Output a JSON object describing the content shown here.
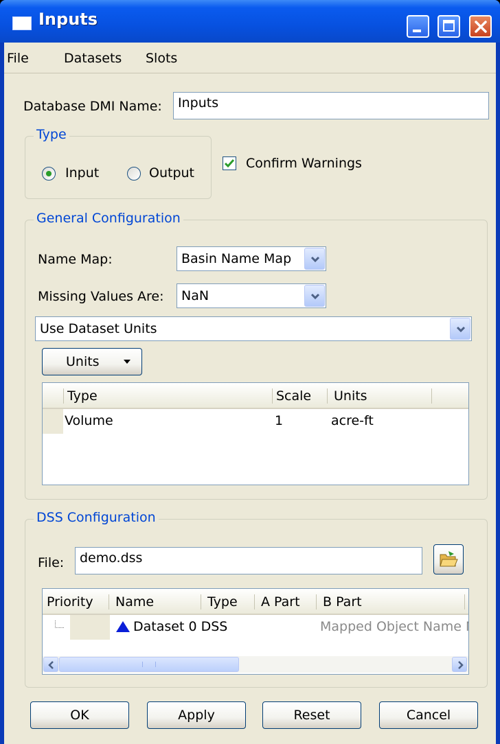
{
  "window": {
    "title": "Inputs",
    "controls": {
      "minimize": "minimize-icon",
      "maximize": "maximize-icon",
      "close": "close-icon"
    }
  },
  "menubar": {
    "items": [
      "File",
      "Datasets",
      "Slots"
    ]
  },
  "dmi_name": {
    "label": "Database DMI Name:",
    "value": "Inputs"
  },
  "type_group": {
    "legend": "Type",
    "options": [
      {
        "label": "Input",
        "selected": true
      },
      {
        "label": "Output",
        "selected": false
      }
    ]
  },
  "confirm_warnings": {
    "label": "Confirm Warnings",
    "checked": true
  },
  "general": {
    "legend": "General Configuration",
    "name_map": {
      "label": "Name Map:",
      "value": "Basin Name Map"
    },
    "missing_values": {
      "label": "Missing Values Are:",
      "value": "NaN"
    },
    "units_mode": {
      "value": "Use Dataset Units"
    },
    "units_button": "Units",
    "units_table": {
      "columns": [
        "Type",
        "Scale",
        "Units"
      ],
      "rows": [
        {
          "type": "Volume",
          "scale": "1",
          "units": "acre-ft"
        }
      ]
    }
  },
  "dss": {
    "legend": "DSS Configuration",
    "file": {
      "label": "File:",
      "value": "demo.dss",
      "browse_icon": "open-folder-icon"
    },
    "table": {
      "columns": [
        "Priority",
        "Name",
        "Type",
        "A Part",
        "B Part"
      ],
      "rows": [
        {
          "priority": "",
          "name": "Dataset 0 DSS",
          "icon": "triangle-icon",
          "b_part": "Mapped Object Name N"
        }
      ]
    }
  },
  "buttons": {
    "ok": "OK",
    "apply": "Apply",
    "reset": "Reset",
    "cancel": "Cancel"
  },
  "colors": {
    "title_blue": "#0751e0",
    "legend_blue": "#0046d5",
    "check_green": "#2a9c2a",
    "dialog_bg": "#ece9d8"
  }
}
